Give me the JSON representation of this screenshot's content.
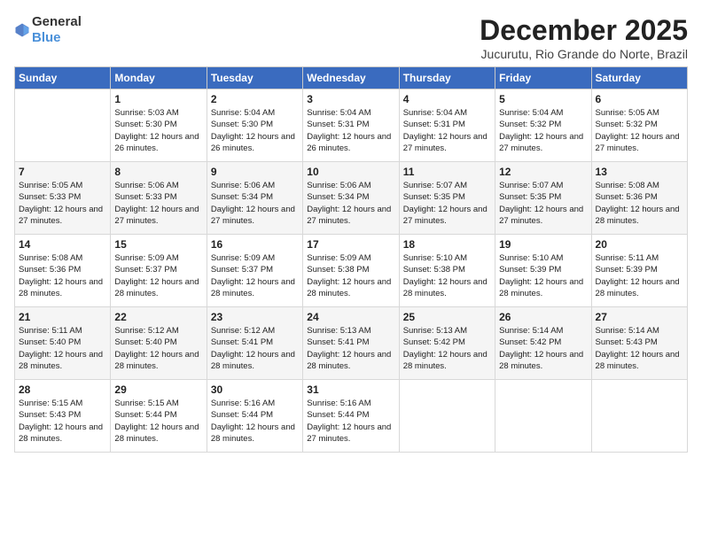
{
  "header": {
    "logo_general": "General",
    "logo_blue": "Blue",
    "month_title": "December 2025",
    "location": "Jucurutu, Rio Grande do Norte, Brazil"
  },
  "days_of_week": [
    "Sunday",
    "Monday",
    "Tuesday",
    "Wednesday",
    "Thursday",
    "Friday",
    "Saturday"
  ],
  "weeks": [
    [
      {
        "day": "",
        "info": ""
      },
      {
        "day": "1",
        "info": "Sunrise: 5:03 AM\nSunset: 5:30 PM\nDaylight: 12 hours and 26 minutes."
      },
      {
        "day": "2",
        "info": "Sunrise: 5:04 AM\nSunset: 5:30 PM\nDaylight: 12 hours and 26 minutes."
      },
      {
        "day": "3",
        "info": "Sunrise: 5:04 AM\nSunset: 5:31 PM\nDaylight: 12 hours and 26 minutes."
      },
      {
        "day": "4",
        "info": "Sunrise: 5:04 AM\nSunset: 5:31 PM\nDaylight: 12 hours and 27 minutes."
      },
      {
        "day": "5",
        "info": "Sunrise: 5:04 AM\nSunset: 5:32 PM\nDaylight: 12 hours and 27 minutes."
      },
      {
        "day": "6",
        "info": "Sunrise: 5:05 AM\nSunset: 5:32 PM\nDaylight: 12 hours and 27 minutes."
      }
    ],
    [
      {
        "day": "7",
        "info": "Sunrise: 5:05 AM\nSunset: 5:33 PM\nDaylight: 12 hours and 27 minutes."
      },
      {
        "day": "8",
        "info": "Sunrise: 5:06 AM\nSunset: 5:33 PM\nDaylight: 12 hours and 27 minutes."
      },
      {
        "day": "9",
        "info": "Sunrise: 5:06 AM\nSunset: 5:34 PM\nDaylight: 12 hours and 27 minutes."
      },
      {
        "day": "10",
        "info": "Sunrise: 5:06 AM\nSunset: 5:34 PM\nDaylight: 12 hours and 27 minutes."
      },
      {
        "day": "11",
        "info": "Sunrise: 5:07 AM\nSunset: 5:35 PM\nDaylight: 12 hours and 27 minutes."
      },
      {
        "day": "12",
        "info": "Sunrise: 5:07 AM\nSunset: 5:35 PM\nDaylight: 12 hours and 27 minutes."
      },
      {
        "day": "13",
        "info": "Sunrise: 5:08 AM\nSunset: 5:36 PM\nDaylight: 12 hours and 28 minutes."
      }
    ],
    [
      {
        "day": "14",
        "info": "Sunrise: 5:08 AM\nSunset: 5:36 PM\nDaylight: 12 hours and 28 minutes."
      },
      {
        "day": "15",
        "info": "Sunrise: 5:09 AM\nSunset: 5:37 PM\nDaylight: 12 hours and 28 minutes."
      },
      {
        "day": "16",
        "info": "Sunrise: 5:09 AM\nSunset: 5:37 PM\nDaylight: 12 hours and 28 minutes."
      },
      {
        "day": "17",
        "info": "Sunrise: 5:09 AM\nSunset: 5:38 PM\nDaylight: 12 hours and 28 minutes."
      },
      {
        "day": "18",
        "info": "Sunrise: 5:10 AM\nSunset: 5:38 PM\nDaylight: 12 hours and 28 minutes."
      },
      {
        "day": "19",
        "info": "Sunrise: 5:10 AM\nSunset: 5:39 PM\nDaylight: 12 hours and 28 minutes."
      },
      {
        "day": "20",
        "info": "Sunrise: 5:11 AM\nSunset: 5:39 PM\nDaylight: 12 hours and 28 minutes."
      }
    ],
    [
      {
        "day": "21",
        "info": "Sunrise: 5:11 AM\nSunset: 5:40 PM\nDaylight: 12 hours and 28 minutes."
      },
      {
        "day": "22",
        "info": "Sunrise: 5:12 AM\nSunset: 5:40 PM\nDaylight: 12 hours and 28 minutes."
      },
      {
        "day": "23",
        "info": "Sunrise: 5:12 AM\nSunset: 5:41 PM\nDaylight: 12 hours and 28 minutes."
      },
      {
        "day": "24",
        "info": "Sunrise: 5:13 AM\nSunset: 5:41 PM\nDaylight: 12 hours and 28 minutes."
      },
      {
        "day": "25",
        "info": "Sunrise: 5:13 AM\nSunset: 5:42 PM\nDaylight: 12 hours and 28 minutes."
      },
      {
        "day": "26",
        "info": "Sunrise: 5:14 AM\nSunset: 5:42 PM\nDaylight: 12 hours and 28 minutes."
      },
      {
        "day": "27",
        "info": "Sunrise: 5:14 AM\nSunset: 5:43 PM\nDaylight: 12 hours and 28 minutes."
      }
    ],
    [
      {
        "day": "28",
        "info": "Sunrise: 5:15 AM\nSunset: 5:43 PM\nDaylight: 12 hours and 28 minutes."
      },
      {
        "day": "29",
        "info": "Sunrise: 5:15 AM\nSunset: 5:44 PM\nDaylight: 12 hours and 28 minutes."
      },
      {
        "day": "30",
        "info": "Sunrise: 5:16 AM\nSunset: 5:44 PM\nDaylight: 12 hours and 28 minutes."
      },
      {
        "day": "31",
        "info": "Sunrise: 5:16 AM\nSunset: 5:44 PM\nDaylight: 12 hours and 27 minutes."
      },
      {
        "day": "",
        "info": ""
      },
      {
        "day": "",
        "info": ""
      },
      {
        "day": "",
        "info": ""
      }
    ]
  ]
}
